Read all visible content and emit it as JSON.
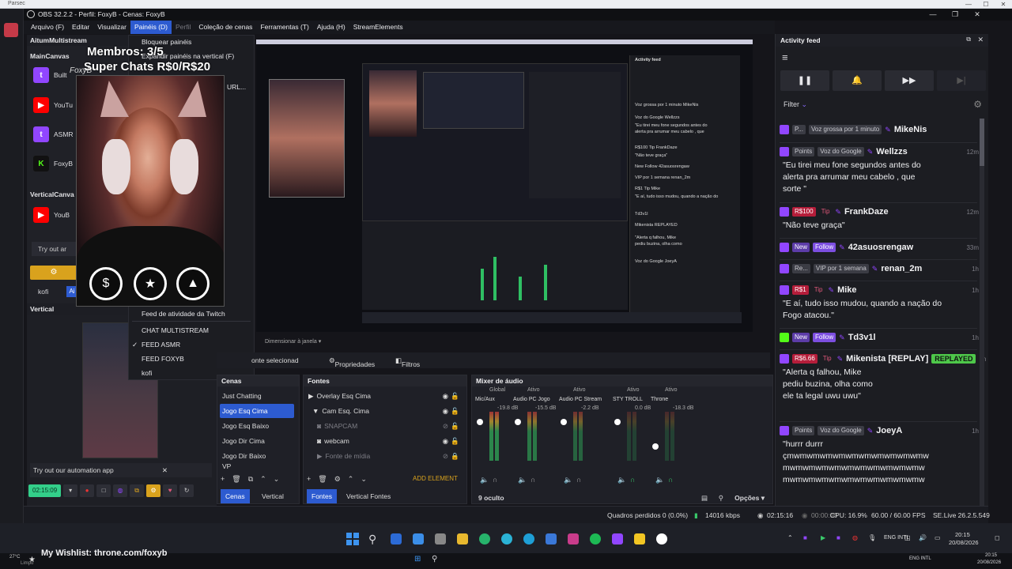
{
  "parsec": {
    "title": "Parsec"
  },
  "obs": {
    "title": "OBS 32.2.2 - Perfil: FoxyB - Cenas: FoxyB"
  },
  "menu": [
    {
      "label": "Arquivo (F)",
      "active": false,
      "dim": false
    },
    {
      "label": "Editar",
      "active": false,
      "dim": false
    },
    {
      "label": "Visualizar",
      "active": false,
      "dim": false
    },
    {
      "label": "Painéis (D)",
      "active": true,
      "dim": false
    },
    {
      "label": "Perfil",
      "active": false,
      "dim": true
    },
    {
      "label": "Coleção de cenas",
      "active": false,
      "dim": false
    },
    {
      "label": "Ferramentas (T)",
      "active": false,
      "dim": false
    },
    {
      "label": "Ajuda (H)",
      "active": false,
      "dim": false
    },
    {
      "label": "StreamElements",
      "active": false,
      "dim": false
    }
  ],
  "multistream": {
    "title": "AitumMultistream",
    "main_label": "MainCanvas",
    "vertical_label": "VerticalCanva",
    "rows": [
      {
        "label": "Built",
        "icon": "twitch-icon"
      },
      {
        "label": "YouTu",
        "icon": "youtube-icon"
      },
      {
        "label": "ASMR",
        "icon": "twitch-icon"
      },
      {
        "label": "FoxyB",
        "icon": "kick-icon"
      }
    ],
    "vertical_rows": [
      {
        "label": "YouB",
        "icon": "youtube-icon"
      }
    ],
    "try": "Try out ar",
    "kofi": "kofi",
    "ai": "Ai"
  },
  "vertical": {
    "title": "Vertical",
    "try": "Try out our automation app",
    "timer": "02:15:09"
  },
  "dropdown": {
    "items": [
      "Bloquear painéis",
      "Expandir painéis na vertical (F)",
      "URL..."
    ],
    "bottom_items": [
      {
        "label": "Feed de atividade da Twitch",
        "checked": false
      },
      {
        "label": "CHAT MULTISTREAM",
        "checked": false
      },
      {
        "label": "FEED ASMR",
        "checked": true
      },
      {
        "label": "FEED FOXYB",
        "checked": false
      },
      {
        "label": "kofi",
        "checked": false
      }
    ]
  },
  "overlay": {
    "membros": "Membros: 3/5",
    "superchats": "Super Chats R$0/R$20",
    "watermark": "FoxyB"
  },
  "preview": {
    "dimension": "Dimensionar à janela"
  },
  "source_toolbar": {
    "selected": "onte selecionad",
    "props": "Propriedades",
    "filters": "Filtros"
  },
  "scenes": {
    "title": "Cenas",
    "items": [
      {
        "label": "Just Chatting",
        "selected": false
      },
      {
        "label": "Jogo Esq Cima",
        "selected": true
      },
      {
        "label": "Jogo Esq Baixo",
        "selected": false
      },
      {
        "label": "Jogo Dir  Cima",
        "selected": false
      },
      {
        "label": "Jogo Dir Baixo",
        "selected": false
      },
      {
        "label": "VP",
        "selected": false
      }
    ],
    "tab1": "Cenas",
    "tab2": "Vertical C..."
  },
  "sources": {
    "title": "Fontes",
    "items": [
      {
        "label": "Overlay Esq Cima",
        "indent": 0,
        "dim": false,
        "glyph": "▶"
      },
      {
        "label": "Cam Esq. Cima",
        "indent": 1,
        "dim": false,
        "glyph": "▼"
      },
      {
        "label": "SNAPCAM",
        "indent": 2,
        "dim": true,
        "glyph": "◉"
      },
      {
        "label": "webcam",
        "indent": 2,
        "dim": false,
        "glyph": "◉"
      },
      {
        "label": "Fonte de mídia",
        "indent": 2,
        "dim": true,
        "glyph": "▶"
      }
    ],
    "add": "ADD ELEMENT",
    "tab1": "Fontes",
    "tab2": "Vertical Fontes"
  },
  "mixer": {
    "title": "Mixer de áudio",
    "channels": [
      {
        "status": "Global",
        "name": "Mic/Aux",
        "db": "-19.8 dB",
        "level": 0.7,
        "fader": 0.85
      },
      {
        "status": "Ativo",
        "name": "Audio PC Jogo",
        "db": "-15.5 dB",
        "level": 0.55,
        "fader": 0.85
      },
      {
        "status": "Ativo",
        "name": "Audio PC Stream",
        "db": "-2.2 dB",
        "level": 0.35,
        "fader": 0.85
      },
      {
        "status": "Ativo",
        "name": "STY TROLL",
        "db": "0.0 dB",
        "level": 0.0,
        "fader": 0.85
      },
      {
        "status": "Ativo",
        "name": "Throne",
        "db": "-18.3 dB",
        "level": 0.0,
        "fader": 0.35
      }
    ],
    "hidden": "9 oculto",
    "options": "Opções"
  },
  "status": {
    "frames": "Quadros perdidos 0 (0.0%)",
    "kbps": "14016 kbps",
    "time1": "02:15:16",
    "time2": "00:00:00",
    "cpu": "CPU: 16.9%",
    "fps": "60.00 / 60.00 FPS",
    "live": "SE.Live 26.2.5.549"
  },
  "activity": {
    "title": "Activity feed",
    "filter": "Filter",
    "events": [
      {
        "icon": "twitch",
        "pill": "P...",
        "pill_style": "grey",
        "tag": "Voz grossa por 1 minuto",
        "tag_style": "grey",
        "user": "MikeNis",
        "time": "",
        "message": ""
      },
      {
        "icon": "twitch",
        "pill": "Points",
        "pill_style": "grey",
        "tag": "Voz do Google",
        "tag_style": "grey",
        "user": "Wellzzs",
        "time": "12m",
        "message": "\"Eu tirei meu fone segundos antes do\nalerta pra arrumar meu cabelo , que\nsorte \""
      },
      {
        "icon": "twitch",
        "pill": "R$100",
        "pill_style": "red",
        "tag": "Tip",
        "tag_style": "tip",
        "user": "FrankDaze",
        "time": "12m",
        "message": "\"Não teve graça\""
      },
      {
        "icon": "twitch",
        "pill": "New",
        "pill_style": "purple",
        "tag": "Follow",
        "tag_style": "follow",
        "user": "42asuosrengaw",
        "time": "33m",
        "message": ""
      },
      {
        "icon": "twitch",
        "pill": "Re...",
        "pill_style": "grey",
        "tag": "VIP por 1 semana",
        "tag_style": "grey",
        "user": "renan_2m",
        "time": "1h",
        "message": ""
      },
      {
        "icon": "twitch",
        "pill": "R$1",
        "pill_style": "red",
        "tag": "Tip",
        "tag_style": "tip",
        "user": "Mike",
        "time": "1h",
        "message": "\"E aí, tudo isso mudou, quando a nação do\nFogo atacou.\""
      },
      {
        "icon": "kick",
        "pill": "New",
        "pill_style": "purple",
        "tag": "Follow",
        "tag_style": "follow",
        "user": "Td3v1l",
        "time": "1h",
        "message": ""
      },
      {
        "icon": "twitch",
        "pill": "R$6.66",
        "pill_style": "red",
        "tag": "Tip",
        "tag_style": "tip",
        "user": "Mikenista [REPLAY]",
        "time": "1h",
        "badge": "REPLAYED",
        "message": "\"Alerta q falhou, Mike\npediu buzina, olha como\nele ta legal uwu uwu\""
      },
      {
        "icon": "twitch",
        "pill": "Points",
        "pill_style": "grey",
        "tag": "Voz do Google",
        "tag_style": "grey",
        "user": "JoeyA",
        "time": "1h",
        "message": "\"hurrr durrr\nçmwmwmwmwmwmwmwmwmwmwmw\nmwmwmwmwmwmwmwmwmwmwmw\nmwmwmwmwmwmwmwmwmwmwmw"
      }
    ]
  },
  "taskbar": {
    "lang": "ENG\nINTL",
    "clock": "20:15",
    "date": "20/08/2026"
  },
  "bottom": {
    "wishlist": "My Wishlist: throne.com/foxyb",
    "lang": "ENG\nINTL",
    "clock": "20:15",
    "date": "20/08/2026",
    "temp": "27°C",
    "weather": "Limpo"
  },
  "preview_side": {
    "title": "Activity feed",
    "lines": [
      "Voz grossa por 1 minuto MikeNis",
      "Voz do Google Wellzzs",
      "\"Eu tirei meu fone segundos antes do",
      "alerta pra arrumar meu cabelo , que",
      "R$100 Tip FrankDaze",
      "\"Não teve graça\"",
      "New Follow 42asuosrengaw",
      "VIP por 1 semana renan_2m",
      "R$1 Tip Mike",
      "\"E aí, tudo isso mudou, quando a nação do",
      "Td3v1l",
      "Mikenista REPLAYED",
      "\"Alerta q falhou, Mike",
      "pediu buzina, olha como",
      "Voz do Google JoeyA"
    ]
  }
}
